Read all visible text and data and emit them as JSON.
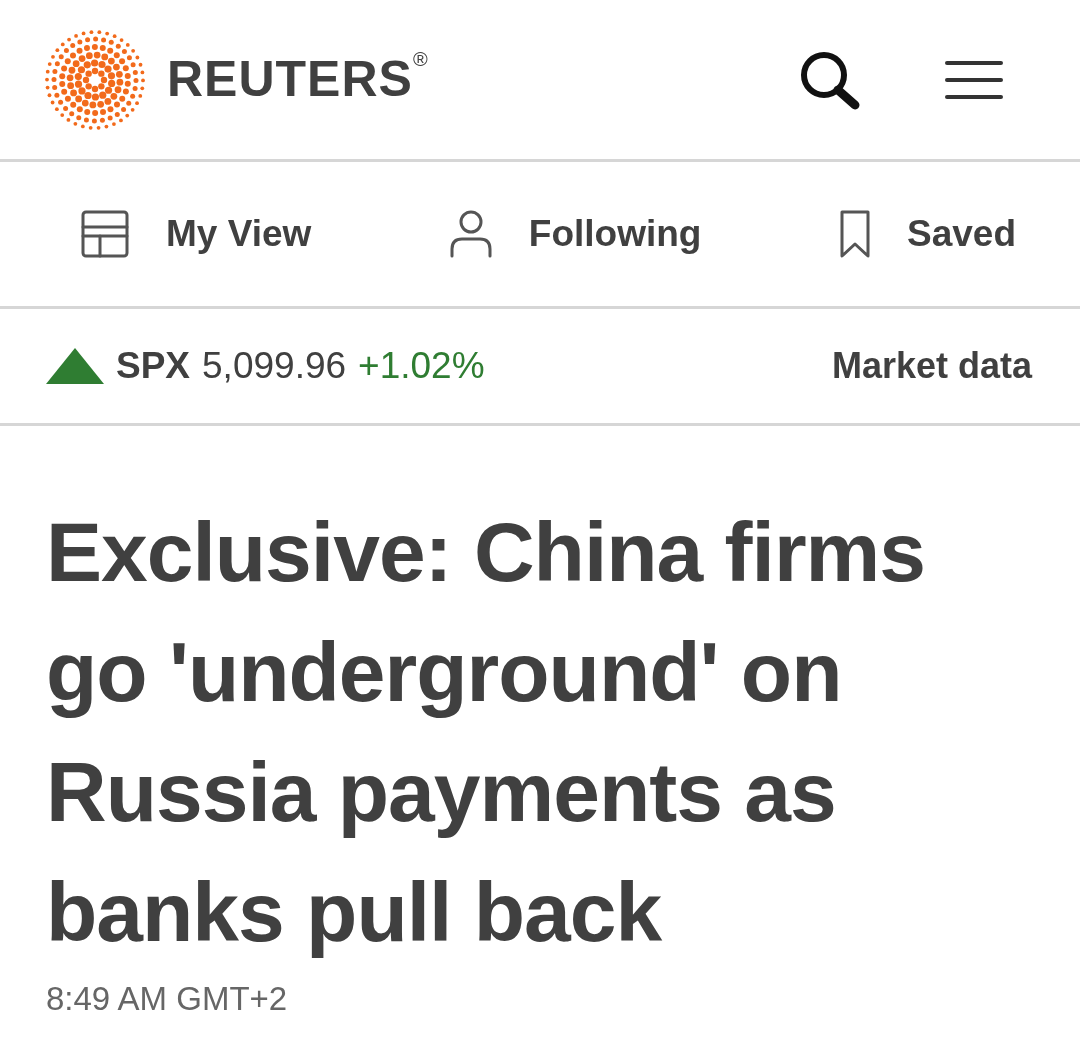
{
  "header": {
    "brand": "REUTERS",
    "brand_mark": "®"
  },
  "nav": [
    {
      "kind": "layout",
      "label": "My View"
    },
    {
      "kind": "person",
      "label": "Following"
    },
    {
      "kind": "bookmark",
      "label": "Saved"
    }
  ],
  "ticker": {
    "rising": true,
    "symbol": "SPX",
    "value": "5,099.96",
    "change": "+1.02%",
    "link": "Market data"
  },
  "article": {
    "headline": "Exclusive: China firms go 'underground' on Russia payments as banks pull back",
    "timestamp": "8:49 AM GMT+2"
  }
}
